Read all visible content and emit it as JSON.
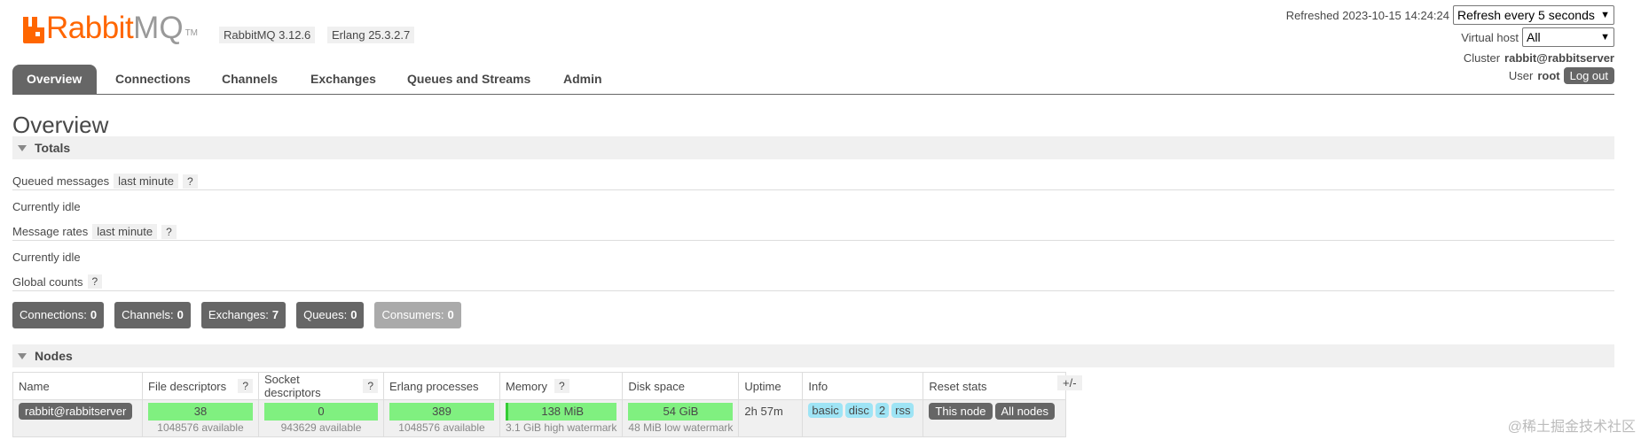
{
  "header": {
    "logo_rabbit": "Rabbit",
    "logo_mq": "MQ",
    "logo_tm": "TM",
    "rabbitmq_version": "RabbitMQ 3.12.6",
    "erlang_version": "Erlang 25.3.2.7"
  },
  "topright": {
    "refreshed_label": "Refreshed 2023-10-15 14:24:24",
    "refresh_select": "Refresh every 5 seconds",
    "vhost_label": "Virtual host",
    "vhost_select": "All",
    "cluster_label": "Cluster",
    "cluster_value": "rabbit@rabbitserver",
    "user_label": "User",
    "user_value": "root",
    "logout": "Log out"
  },
  "tabs": [
    "Overview",
    "Connections",
    "Channels",
    "Exchanges",
    "Queues and Streams",
    "Admin"
  ],
  "page_title": "Overview",
  "totals": {
    "title": "Totals",
    "queued_messages_label": "Queued messages",
    "queued_range": "last minute",
    "help": "?",
    "queued_status": "Currently idle",
    "message_rates_label": "Message rates",
    "rates_range": "last minute",
    "rates_status": "Currently idle",
    "global_counts_label": "Global counts"
  },
  "counts": [
    {
      "label": "Connections:",
      "value": "0"
    },
    {
      "label": "Channels:",
      "value": "0"
    },
    {
      "label": "Exchanges:",
      "value": "7"
    },
    {
      "label": "Queues:",
      "value": "0"
    },
    {
      "label": "Consumers:",
      "value": "0"
    }
  ],
  "nodes": {
    "title": "Nodes",
    "columns": [
      "Name",
      "File descriptors",
      "Socket descriptors",
      "Erlang processes",
      "Memory",
      "Disk space",
      "Uptime",
      "Info",
      "Reset stats"
    ],
    "row": {
      "name": "rabbit@rabbitserver",
      "file_descriptors": "38",
      "file_descriptors_sub": "1048576 available",
      "socket_descriptors": "0",
      "socket_descriptors_sub": "943629 available",
      "erlang_processes": "389",
      "erlang_processes_sub": "1048576 available",
      "memory": "138 MiB",
      "memory_sub": "3.1 GiB high watermark",
      "disk": "54 GiB",
      "disk_sub": "48 MiB low watermark",
      "uptime": "2h 57m",
      "info_tags": [
        "basic",
        "disc",
        "2",
        "rss"
      ],
      "reset_this": "This node",
      "reset_all": "All nodes"
    },
    "plus_minus": "+/-"
  },
  "watermark": "@稀土掘金技术社区"
}
